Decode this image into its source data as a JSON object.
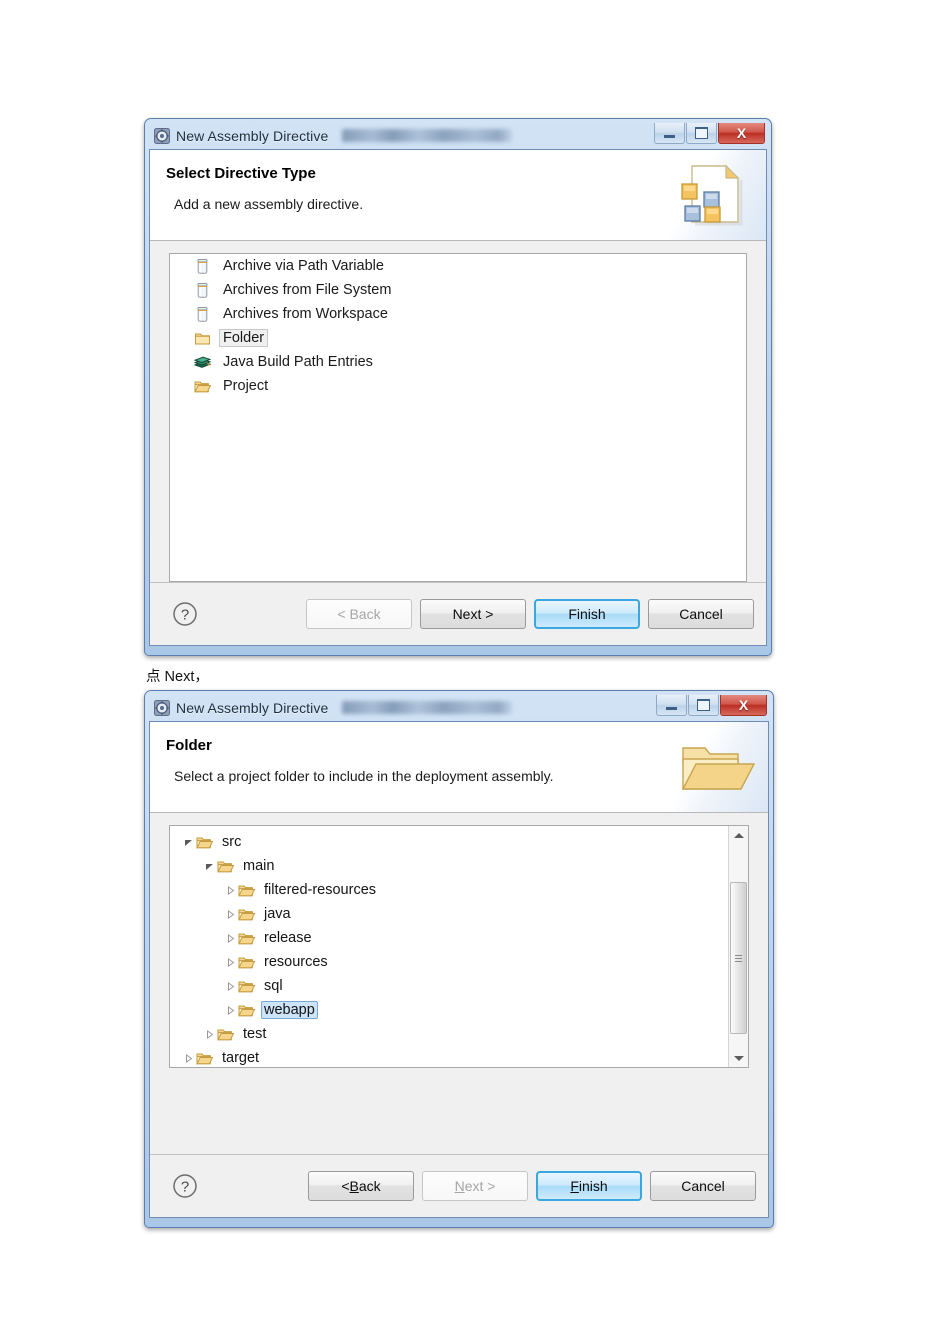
{
  "page": {
    "between_caption": "点 Next，"
  },
  "dialog1": {
    "titlebar": {
      "title": "New Assembly Directive",
      "icon": "eclipse-wizard-icon",
      "blurred_text": "",
      "minimize_label": "",
      "maximize_label": "",
      "close_label": "X"
    },
    "header": {
      "title": "Select Directive Type",
      "subtitle": "Add a new assembly directive.",
      "banner_icon": "assembly-directive-banner-icon"
    },
    "list": [
      {
        "label": "Archive via Path Variable",
        "icon": "jar-icon",
        "selected": false
      },
      {
        "label": "Archives from File System",
        "icon": "jar-icon",
        "selected": false
      },
      {
        "label": "Archives from Workspace",
        "icon": "jar-icon",
        "selected": false
      },
      {
        "label": "Folder",
        "icon": "folder-icon",
        "selected": true
      },
      {
        "label": "Java Build Path Entries",
        "icon": "java-build-path-icon",
        "selected": false
      },
      {
        "label": "Project",
        "icon": "project-folder-icon",
        "selected": false
      }
    ],
    "buttons": {
      "help": "?",
      "back": "< Back",
      "next": "Next >",
      "finish": "Finish",
      "cancel": "Cancel",
      "back_disabled": true,
      "next_disabled": false,
      "default_button": "Finish"
    }
  },
  "dialog2": {
    "titlebar": {
      "title": "New Assembly Directive",
      "icon": "eclipse-wizard-icon",
      "close_label": "X"
    },
    "header": {
      "title": "Folder",
      "subtitle": "Select a project folder to include in the deployment assembly.",
      "banner_icon": "open-folder-banner-icon"
    },
    "tree": [
      {
        "label": "src",
        "depth": 0,
        "arrow": "expanded",
        "icon": "open-folder-icon",
        "selected": false
      },
      {
        "label": "main",
        "depth": 1,
        "arrow": "expanded",
        "icon": "open-folder-icon",
        "selected": false
      },
      {
        "label": "filtered-resources",
        "depth": 2,
        "arrow": "collapsed",
        "icon": "open-folder-icon",
        "selected": false
      },
      {
        "label": "java",
        "depth": 2,
        "arrow": "collapsed",
        "icon": "open-folder-icon",
        "selected": false
      },
      {
        "label": "release",
        "depth": 2,
        "arrow": "collapsed",
        "icon": "open-folder-icon",
        "selected": false
      },
      {
        "label": "resources",
        "depth": 2,
        "arrow": "collapsed",
        "icon": "open-folder-icon",
        "selected": false
      },
      {
        "label": "sql",
        "depth": 2,
        "arrow": "collapsed",
        "icon": "open-folder-icon",
        "selected": false
      },
      {
        "label": "webapp",
        "depth": 2,
        "arrow": "collapsed",
        "icon": "open-folder-icon",
        "selected": true
      },
      {
        "label": "test",
        "depth": 1,
        "arrow": "collapsed",
        "icon": "open-folder-icon",
        "selected": false
      },
      {
        "label": "target",
        "depth": 0,
        "arrow": "collapsed",
        "icon": "open-folder-icon",
        "selected": false
      }
    ],
    "scrollbar": {
      "up_arrow": "scroll-up-icon",
      "down_arrow": "scroll-down-icon"
    },
    "buttons": {
      "help": "?",
      "back_prefix": "< ",
      "back_mnemonic": "B",
      "back_rest": "ack",
      "next_mnemonic": "N",
      "next_rest": "ext >",
      "finish_mnemonic": "F",
      "finish_rest": "inish",
      "cancel": "Cancel",
      "back_disabled": false,
      "next_disabled": true,
      "default_button": "Finish"
    }
  },
  "colors": {
    "accent": "#3ba7e0",
    "title_bar": "#bed6ef",
    "close_button": "#bb2f24",
    "folder": "#f0c16a",
    "selection": "#cde3f7"
  }
}
